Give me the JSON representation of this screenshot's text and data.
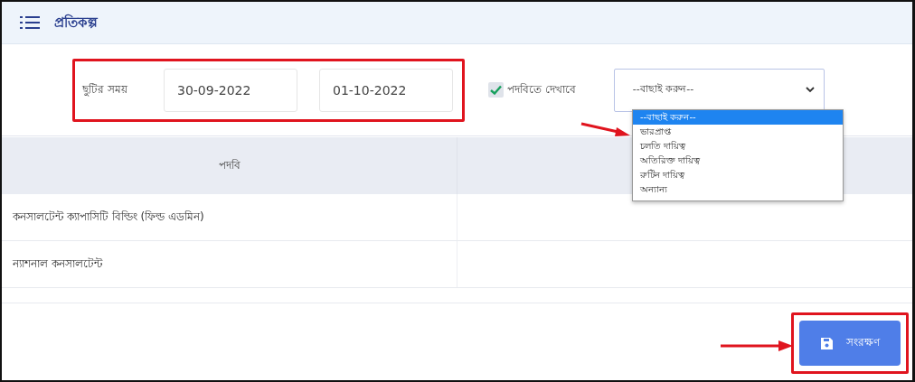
{
  "header": {
    "title": "প্রতিকল্প"
  },
  "filter": {
    "leave_label": "ছুটির সময়",
    "date_from": "30-09-2022",
    "date_to": "01-10-2022",
    "show_in_designation": {
      "label": "পদবিতে দেখাবে",
      "checked": true
    },
    "select": {
      "value": "--বাছাই করুন--",
      "expanded": true,
      "options": [
        {
          "label": "--বাছাই করুন--",
          "selected": true
        },
        {
          "label": "ভারপ্রাপ্ত",
          "selected": false
        },
        {
          "label": "চলতি দায়িত্ব",
          "selected": false
        },
        {
          "label": "অতিরিক্ত দায়িত্ব",
          "selected": false
        },
        {
          "label": "রুটিন দায়িত্ব",
          "selected": false
        },
        {
          "label": "অন্যান্য",
          "selected": false
        }
      ]
    }
  },
  "table": {
    "columns": [
      "পদবি"
    ],
    "rows": [
      {
        "designation": "কনসালটেন্ট ক্যাপাসিটি বিল্ডিং (ফিল্ড এডমিন)"
      },
      {
        "designation": "ন্যাশনাল কনসালটেন্ট"
      }
    ]
  },
  "save_button": {
    "label": "সংরক্ষণ"
  }
}
